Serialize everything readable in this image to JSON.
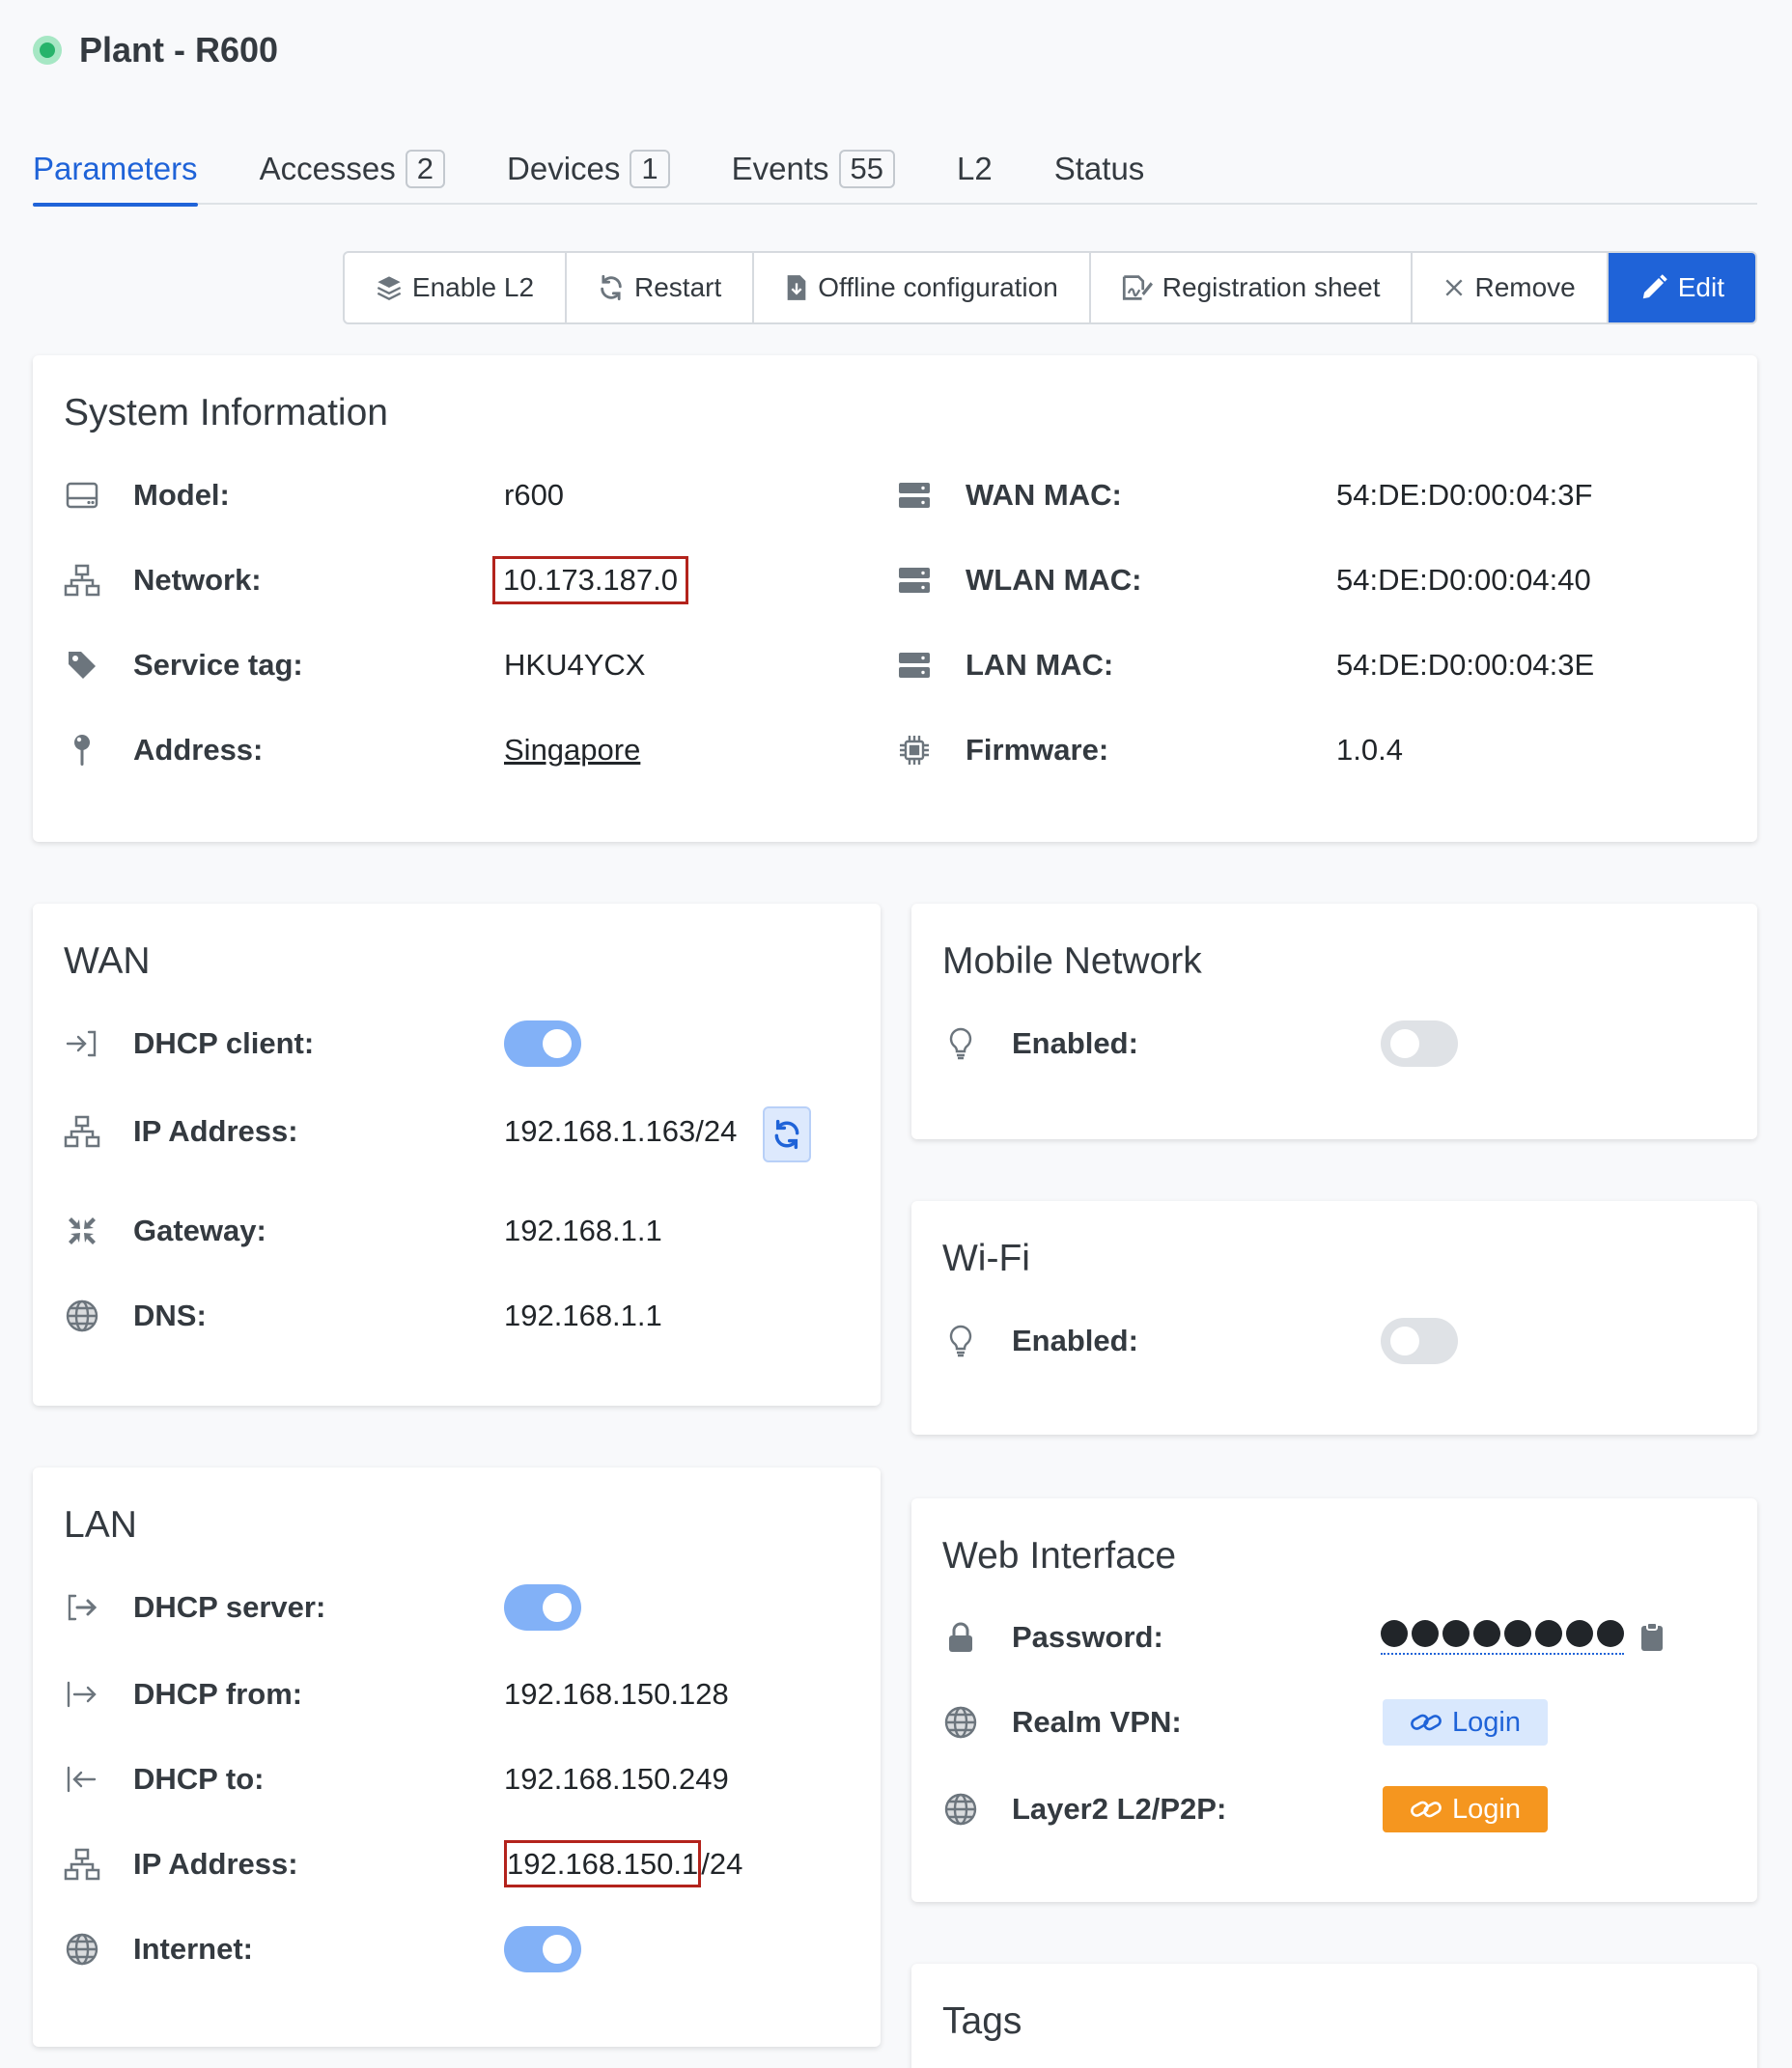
{
  "header": {
    "title": "Plant - R600",
    "status_color": "#27b36b"
  },
  "tabs": [
    {
      "label": "Parameters",
      "active": true
    },
    {
      "label": "Accesses",
      "badge": "2"
    },
    {
      "label": "Devices",
      "badge": "1"
    },
    {
      "label": "Events",
      "badge": "55"
    },
    {
      "label": "L2"
    },
    {
      "label": "Status"
    }
  ],
  "toolbar": {
    "enable_l2": "Enable L2",
    "restart": "Restart",
    "offline_configuration": "Offline configuration",
    "registration_sheet": "Registration sheet",
    "remove": "Remove",
    "edit": "Edit"
  },
  "system": {
    "title": "System Information",
    "model_label": "Model:",
    "model_value": "r600",
    "network_label": "Network:",
    "network_value": "10.173.187.0",
    "service_tag_label": "Service tag:",
    "service_tag_value": "HKU4YCX",
    "address_label": "Address:",
    "address_value": "Singapore",
    "wan_mac_label": "WAN MAC:",
    "wan_mac_value": "54:DE:D0:00:04:3F",
    "wlan_mac_label": "WLAN MAC:",
    "wlan_mac_value": "54:DE:D0:00:04:40",
    "lan_mac_label": "LAN MAC:",
    "lan_mac_value": "54:DE:D0:00:04:3E",
    "firmware_label": "Firmware:",
    "firmware_value": "1.0.4"
  },
  "wan": {
    "title": "WAN",
    "dhcp_client_label": "DHCP client:",
    "dhcp_client_on": true,
    "ip_label": "IP Address:",
    "ip_value": "192.168.1.163/24",
    "gateway_label": "Gateway:",
    "gateway_value": "192.168.1.1",
    "dns_label": "DNS:",
    "dns_value": "192.168.1.1"
  },
  "lan": {
    "title": "LAN",
    "dhcp_server_label": "DHCP server:",
    "dhcp_server_on": true,
    "dhcp_from_label": "DHCP from:",
    "dhcp_from_value": "192.168.150.128",
    "dhcp_to_label": "DHCP to:",
    "dhcp_to_value": "192.168.150.249",
    "ip_label": "IP Address:",
    "ip_value": "192.168.150.1",
    "ip_suffix": "/24",
    "internet_label": "Internet:",
    "internet_on": true
  },
  "mobile": {
    "title": "Mobile Network",
    "enabled_label": "Enabled:",
    "enabled_on": false
  },
  "wifi": {
    "title": "Wi-Fi",
    "enabled_label": "Enabled:",
    "enabled_on": false
  },
  "web": {
    "title": "Web Interface",
    "password_label": "Password:",
    "realm_vpn_label": "Realm VPN:",
    "realm_vpn_button": "Login",
    "layer2_label": "Layer2 L2/P2P:",
    "layer2_button": "Login"
  },
  "tags": {
    "title": "Tags"
  },
  "colors": {
    "primary": "#1f63d8",
    "orange": "#f5961f",
    "toggle_on": "#82b1f7"
  }
}
